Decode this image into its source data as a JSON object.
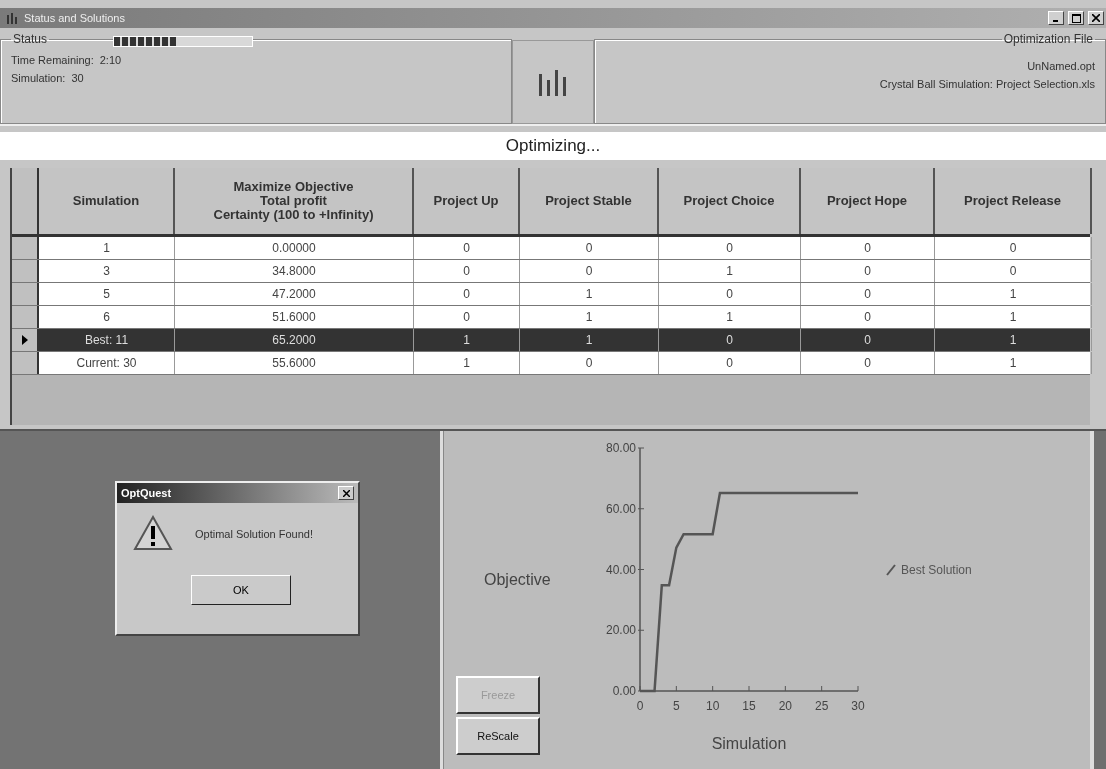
{
  "window": {
    "title": "Status and Solutions"
  },
  "status": {
    "label": "Status",
    "progress": {
      "level": 0.45
    },
    "time_remaining_label": "Time Remaining:",
    "time_remaining": "2:10",
    "simulation_label": "Simulation:",
    "simulation": "30"
  },
  "optimization_file": {
    "label": "Optimization File",
    "file": "UnNamed.opt",
    "model": "Crystal Ball Simulation: Project Selection.xls"
  },
  "message": "Optimizing...",
  "table": {
    "columns": [
      "Simulation",
      "Maximize Objective\nTotal profit\nCertainty (100 to +Infinity)",
      "Project Up",
      "Project Stable",
      "Project Choice",
      "Project Hope",
      "Project Release"
    ],
    "rows": [
      {
        "selected": false,
        "cells": [
          "1",
          "0.00000",
          "0",
          "0",
          "0",
          "0",
          "0"
        ]
      },
      {
        "selected": false,
        "cells": [
          "3",
          "34.8000",
          "0",
          "0",
          "1",
          "0",
          "0"
        ]
      },
      {
        "selected": false,
        "cells": [
          "5",
          "47.2000",
          "0",
          "1",
          "0",
          "0",
          "1"
        ]
      },
      {
        "selected": false,
        "cells": [
          "6",
          "51.6000",
          "0",
          "1",
          "1",
          "0",
          "1"
        ]
      },
      {
        "selected": true,
        "cells": [
          "Best: 11",
          "65.2000",
          "1",
          "1",
          "0",
          "0",
          "1"
        ]
      },
      {
        "selected": false,
        "cells": [
          "Current: 30",
          "55.6000",
          "1",
          "0",
          "0",
          "0",
          "1"
        ]
      }
    ]
  },
  "chart_panel": {
    "buttons": [
      {
        "label": "Freeze",
        "disabled": true
      },
      {
        "label": "ReScale",
        "disabled": false
      }
    ],
    "chart_data": {
      "type": "line",
      "xlabel": "Simulation",
      "ylabel": "Objective",
      "x": [
        0,
        2,
        3,
        4,
        5,
        6,
        10,
        11,
        30
      ],
      "series": [
        {
          "name": "Best Solution",
          "color": "#555555",
          "values": [
            0,
            0,
            34.8,
            34.8,
            47.2,
            51.6,
            51.6,
            65.2,
            65.2
          ]
        }
      ],
      "xlim": [
        0,
        30
      ],
      "ylim": [
        0,
        80
      ],
      "xticks": [
        0,
        5,
        10,
        15,
        20,
        25,
        30
      ],
      "yticks": [
        {
          "value": 0,
          "label": "0.00"
        },
        {
          "value": 20,
          "label": "20.00"
        },
        {
          "value": 40,
          "label": "40.00"
        },
        {
          "value": 60,
          "label": "60.00"
        },
        {
          "value": 80,
          "label": "80.00"
        }
      ]
    }
  },
  "dialog": {
    "title": "OptQuest",
    "message": "Optimal Solution Found!",
    "button": "OK"
  }
}
